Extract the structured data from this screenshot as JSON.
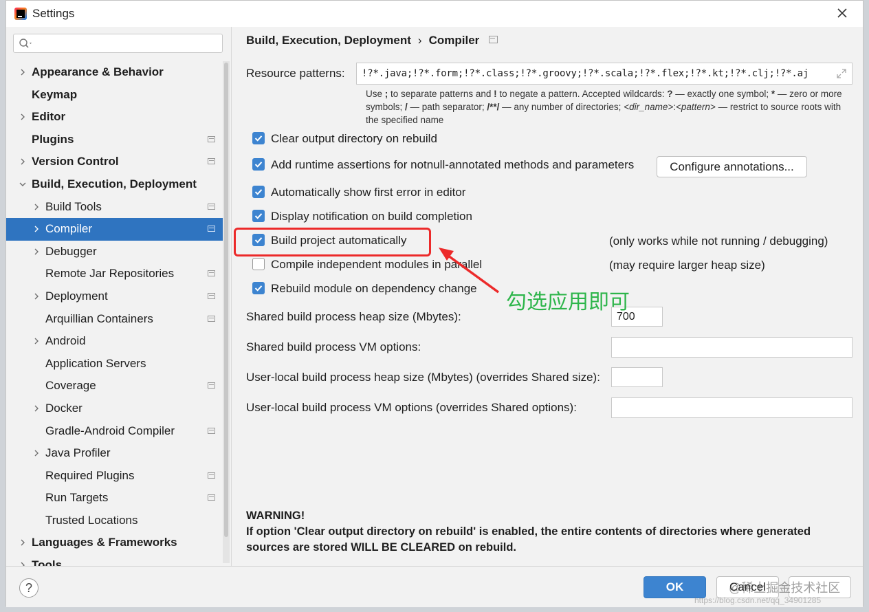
{
  "window": {
    "title": "Settings"
  },
  "sidebar": {
    "items": [
      {
        "label": "Appearance & Behavior",
        "level": 0,
        "arrow": true,
        "bold": true,
        "proj": false,
        "selected": false
      },
      {
        "label": "Keymap",
        "level": 0,
        "arrow": false,
        "bold": true,
        "proj": false,
        "selected": false
      },
      {
        "label": "Editor",
        "level": 0,
        "arrow": true,
        "bold": true,
        "proj": false,
        "selected": false
      },
      {
        "label": "Plugins",
        "level": 0,
        "arrow": false,
        "bold": true,
        "proj": true,
        "selected": false
      },
      {
        "label": "Version Control",
        "level": 0,
        "arrow": true,
        "bold": true,
        "proj": true,
        "selected": false
      },
      {
        "label": "Build, Execution, Deployment",
        "level": 0,
        "arrow": "down",
        "bold": true,
        "proj": false,
        "selected": false
      },
      {
        "label": "Build Tools",
        "level": 1,
        "arrow": true,
        "bold": false,
        "proj": true,
        "selected": false
      },
      {
        "label": "Compiler",
        "level": 1,
        "arrow": true,
        "bold": false,
        "proj": true,
        "selected": true
      },
      {
        "label": "Debugger",
        "level": 1,
        "arrow": true,
        "bold": false,
        "proj": false,
        "selected": false
      },
      {
        "label": "Remote Jar Repositories",
        "level": 1,
        "arrow": false,
        "bold": false,
        "proj": true,
        "selected": false
      },
      {
        "label": "Deployment",
        "level": 1,
        "arrow": true,
        "bold": false,
        "proj": true,
        "selected": false
      },
      {
        "label": "Arquillian Containers",
        "level": 1,
        "arrow": false,
        "bold": false,
        "proj": true,
        "selected": false
      },
      {
        "label": "Android",
        "level": 1,
        "arrow": true,
        "bold": false,
        "proj": false,
        "selected": false
      },
      {
        "label": "Application Servers",
        "level": 1,
        "arrow": false,
        "bold": false,
        "proj": false,
        "selected": false
      },
      {
        "label": "Coverage",
        "level": 1,
        "arrow": false,
        "bold": false,
        "proj": true,
        "selected": false
      },
      {
        "label": "Docker",
        "level": 1,
        "arrow": true,
        "bold": false,
        "proj": false,
        "selected": false
      },
      {
        "label": "Gradle-Android Compiler",
        "level": 1,
        "arrow": false,
        "bold": false,
        "proj": true,
        "selected": false
      },
      {
        "label": "Java Profiler",
        "level": 1,
        "arrow": true,
        "bold": false,
        "proj": false,
        "selected": false
      },
      {
        "label": "Required Plugins",
        "level": 1,
        "arrow": false,
        "bold": false,
        "proj": true,
        "selected": false
      },
      {
        "label": "Run Targets",
        "level": 1,
        "arrow": false,
        "bold": false,
        "proj": true,
        "selected": false
      },
      {
        "label": "Trusted Locations",
        "level": 1,
        "arrow": false,
        "bold": false,
        "proj": false,
        "selected": false
      },
      {
        "label": "Languages & Frameworks",
        "level": 0,
        "arrow": true,
        "bold": true,
        "proj": false,
        "selected": false
      },
      {
        "label": "Tools",
        "level": 0,
        "arrow": true,
        "bold": true,
        "proj": false,
        "selected": false
      }
    ]
  },
  "main": {
    "breadcrumb": {
      "parent": "Build, Execution, Deployment",
      "sep": "›",
      "current": "Compiler"
    },
    "resource_patterns": {
      "label": "Resource patterns:",
      "value": "!?*.java;!?*.form;!?*.class;!?*.groovy;!?*.scala;!?*.flex;!?*.kt;!?*.clj;!?*.aj"
    },
    "hint": {
      "p1": "Use ",
      "k1": ";",
      "p2": " to separate patterns and ",
      "k2": "!",
      "p3": " to negate a pattern. Accepted wildcards: ",
      "k3": "?",
      "p4": " — exactly one symbol; ",
      "k4": "*",
      "p5": " — zero or more symbols; ",
      "k5": "/",
      "p6": " — path separator; ",
      "k6": "/**/",
      "p7": " — any number of directories; ",
      "i1": "<dir_name>",
      "p8": ":",
      "i2": "<pattern>",
      "p9": " — restrict to source roots with the specified name"
    },
    "checkboxes": [
      {
        "label": "Clear output directory on rebuild",
        "checked": true
      },
      {
        "label": "Add runtime assertions for notnull-annotated methods and parameters",
        "checked": true
      },
      {
        "label": "Automatically show first error in editor",
        "checked": true
      },
      {
        "label": "Display notification on build completion",
        "checked": true
      },
      {
        "label": "Build project automatically",
        "checked": true
      },
      {
        "label": "Compile independent modules in parallel",
        "checked": false
      },
      {
        "label": "Rebuild module on dependency change",
        "checked": true
      }
    ],
    "configure_button": "Configure annotations...",
    "notes": {
      "build_auto": "(only works while not running / debugging)",
      "parallel": "(may require larger heap size)"
    },
    "fields": {
      "shared_heap_label": "Shared build process heap size (Mbytes):",
      "shared_heap_value": "700",
      "shared_vm_label": "Shared build process VM options:",
      "shared_vm_value": "",
      "local_heap_label": "User-local build process heap size (Mbytes) (overrides Shared size):",
      "local_heap_value": "",
      "local_vm_label": "User-local build process VM options (overrides Shared options):",
      "local_vm_value": ""
    },
    "warning": {
      "title": "WARNING!",
      "text": "If option 'Clear output directory on rebuild' is enabled, the entire contents of directories where generated sources are stored WILL BE CLEARED on rebuild."
    }
  },
  "annotation": {
    "text": "勾选应用即可",
    "color": "#2db54a",
    "box_color": "#ec2a2a"
  },
  "buttons": {
    "help": "?",
    "ok": "OK",
    "cancel": "Cancel",
    "apply": ""
  },
  "watermark": {
    "text": "@稀土掘金技术社区",
    "url": "https://blog.csdn.net/qq_34901285"
  },
  "colors": {
    "selection": "#2f74c0",
    "accent": "#3d84d0"
  }
}
